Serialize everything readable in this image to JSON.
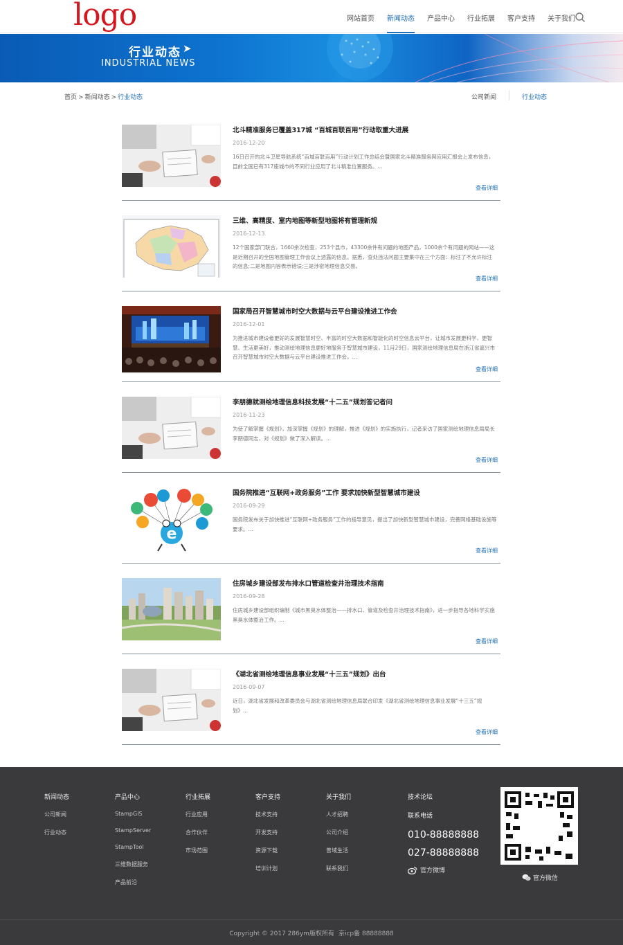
{
  "header": {
    "logo": "logo",
    "nav": [
      "网站首页",
      "新闻动态",
      "产品中心",
      "行业拓展",
      "客户支持",
      "关于我们"
    ],
    "active_nav": "新闻动态"
  },
  "banner": {
    "title": "行业动态",
    "subtitle": "INDUSTRIAL NEWS"
  },
  "breadcrumb": {
    "home": "首页",
    "sep": ">",
    "level1": "新闻动态",
    "current": "行业动态"
  },
  "subnav": [
    "公司新闻",
    "行业动态"
  ],
  "articles": [
    {
      "title": "北斗精准服务已覆盖317城 “百城百联百用”行动取重大进展",
      "date": "2016-12-20",
      "desc": "16日召开的北斗卫星导航系统“百城百联百用”行动计划工作总结会暨国家北斗精准服务网应用汇报会上发布信息，目前全国已有317座城市的不同行业应用了北斗精准位置服务。...",
      "more": "查看详细",
      "thumb": "notebook"
    },
    {
      "title": "三维、高精度、室内地图等新型地图将有管理新规",
      "date": "2016-12-13",
      "desc": "12个国家部门联合，1660余次检查，253个县市，43300余件有问题的地图产品，1000余个有问题的网站——这是近期召开的全国地图管理工作会议上透露的信息。据悉，查处违法问题主要集中在三个方面：标注了不允许标注的信息;二是地图内容表示错误;三是涉密地理信息交易。",
      "more": "查看详细",
      "thumb": "map"
    },
    {
      "title": "国家局召开智慧城市时空大数据与云平台建设推进工作会",
      "date": "2016-12-01",
      "desc": "为推进城市建设者更好的发展智慧时空、丰富的时空大数据和智能化的时空信息云平台，让城市发展更科学、更智慧、生活更美好，推动测绘地理信息更好地服务于智慧城市建设，11月29日，国家测绘地理信息局在浙江省嘉兴市召开智慧城市时空大数据与云平台建设推进工作会。...",
      "more": "查看详细",
      "thumb": "conference"
    },
    {
      "title": "李朋德就测绘地理信息科技发展“十二五”规划答记者问",
      "date": "2016-11-23",
      "desc": "为使了解掌握《规划》，加深掌握《规划》的理解，推进《规划》的实施执行，记者采访了国家测绘地理信息局局长李朋德同志，对《规划》做了深入解读。...",
      "more": "查看详细",
      "thumb": "notebook"
    },
    {
      "title": "国务院推进“互联网+政务服务”工作 要求加快新型智慧城市建设",
      "date": "2016-09-29",
      "desc": "国务院发布关于加快推进“互联网+政务服务”工作的指导意见，提出了加快新型智慧城市建设，完善网络基础设施等要求。...",
      "more": "查看详细",
      "thumb": "balloons"
    },
    {
      "title": "住房城乡建设部发布排水口管道检查井治理技术指南",
      "date": "2016-09-28",
      "desc": "住房城乡建设部组织编制《城市黑臭水体整治——排水口、管道及检查井治理技术指南》，进一步指导各地科学实施黑臭水体整治工作。...",
      "more": "查看详细",
      "thumb": "city"
    },
    {
      "title": "《湖北省测绘地理信息事业发展“十三五”规划》出台",
      "date": "2016-09-07",
      "desc": "近日，湖北省发展和改革委员会与湖北省测绘地理信息局联合印发《湖北省测绘地理信息事业发展“十三五”规划》...",
      "more": "查看详细",
      "thumb": "notebook"
    }
  ],
  "footer": {
    "columns": [
      {
        "head": "新闻动态",
        "links": [
          "公司新闻",
          "行业动态"
        ]
      },
      {
        "head": "产品中心",
        "links": [
          "StampGIS",
          "StampServer",
          "StampTool",
          "三维数据服务",
          "产品前沿"
        ]
      },
      {
        "head": "行业拓展",
        "links": [
          "行业应用",
          "合作伙伴",
          "市场范围"
        ]
      },
      {
        "head": "客户支持",
        "links": [
          "技术支持",
          "开发支持",
          "资源下载",
          "培训计划"
        ]
      },
      {
        "head": "关于我们",
        "links": [
          "人才招聘",
          "公司介绍",
          "普域生活",
          "联系我们"
        ]
      }
    ],
    "tech_forum": "技术论坛",
    "contact_label": "联系电话",
    "phones": [
      "010-88888888",
      "027-88888888"
    ],
    "weibo": "官方微博",
    "wechat": "官方微信",
    "copyright": "Copyright © 2017 286ym版权所有",
    "icp": "京icp备 88888888"
  }
}
